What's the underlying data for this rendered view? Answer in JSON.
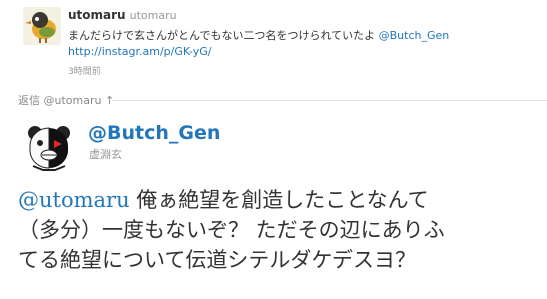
{
  "parent_tweet": {
    "screen_name": "utomaru",
    "full_name": "utomaru",
    "text_before": "まんだらけで玄さんがとんでもない二つ名をつけられていたよ ",
    "mention": "@Butch_Gen",
    "link": "http://instagr.am/p/GK-yG/",
    "time": "3時間前",
    "avatar_icon": "bird-avatar"
  },
  "reply_bar": {
    "label": "返信 @utomaru ↑"
  },
  "main_tweet": {
    "screen_name": "@Butch_Gen",
    "full_name": "虚淵玄",
    "mention": "@utomaru",
    "line1_rest": " 俺ぁ絶望を創造したことなんて",
    "line2": "（多分）一度もないぞ？ ただその辺にありふ",
    "line3": "てる絶望について伝道シテルダケデスヨ？",
    "avatar_icon": "bear-avatar"
  },
  "colors": {
    "link": "#2276bb",
    "muted": "#999999",
    "text": "#333333"
  }
}
